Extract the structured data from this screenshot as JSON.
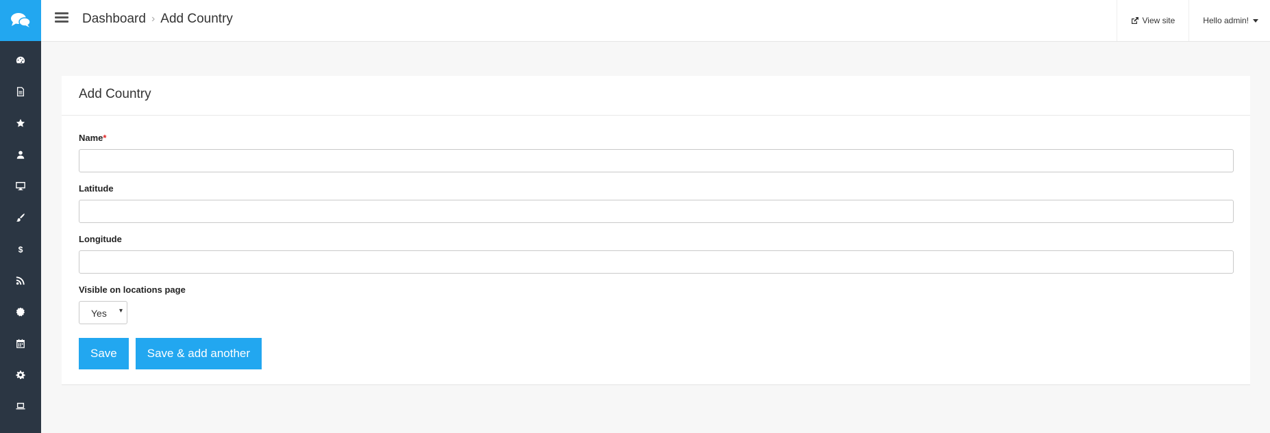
{
  "sidebar": {
    "items": [
      {
        "icon": "dashboard-icon"
      },
      {
        "icon": "document-icon"
      },
      {
        "icon": "star-icon"
      },
      {
        "icon": "user-icon"
      },
      {
        "icon": "desktop-icon"
      },
      {
        "icon": "paintbrush-icon"
      },
      {
        "icon": "dollar-icon"
      },
      {
        "icon": "rss-icon"
      },
      {
        "icon": "certificate-icon"
      },
      {
        "icon": "calendar-icon"
      },
      {
        "icon": "gear-icon"
      },
      {
        "icon": "laptop-icon"
      }
    ]
  },
  "header": {
    "breadcrumb": [
      "Dashboard",
      "Add Country"
    ],
    "view_site": "View site",
    "user_menu": "Hello admin!"
  },
  "form": {
    "title": "Add Country",
    "fields": {
      "name": {
        "label": "Name",
        "required_mark": "*",
        "value": ""
      },
      "latitude": {
        "label": "Latitude",
        "value": ""
      },
      "longitude": {
        "label": "Longitude",
        "value": ""
      },
      "visible": {
        "label": "Visible on locations page",
        "value": "Yes"
      }
    },
    "save_label": "Save",
    "save_add_label": "Save & add another"
  },
  "colors": {
    "accent": "#22a7f0",
    "sidebar": "#2b3643"
  }
}
